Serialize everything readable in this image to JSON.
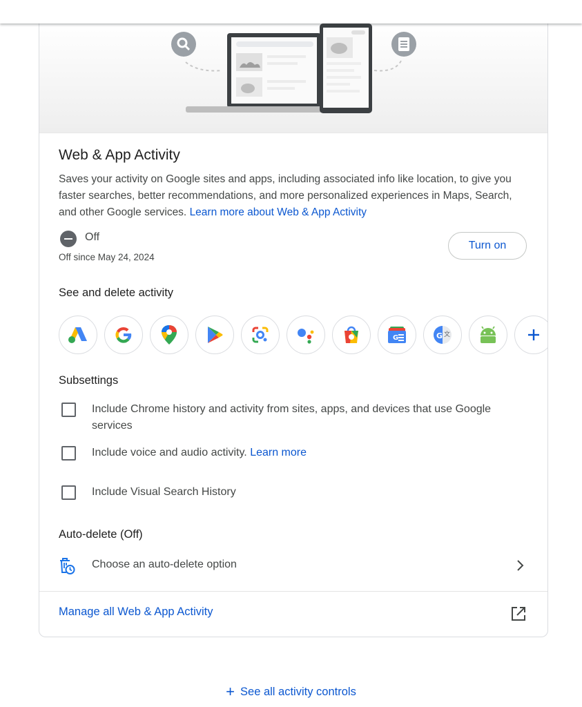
{
  "activity": {
    "title": "Web & App Activity",
    "description": "Saves your activity on Google sites and apps, including associated info like location, to give you faster searches, better recommendations, and more personalized experiences in Maps, Search, and other Google services.",
    "learn_more_link": "Learn more about Web & App Activity",
    "status": "Off",
    "status_since": "Off since May 24, 2024",
    "turn_on_label": "Turn on"
  },
  "see_delete": {
    "heading": "See and delete activity",
    "apps": [
      {
        "icon": "google-ads-icon"
      },
      {
        "icon": "google-icon"
      },
      {
        "icon": "google-maps-icon"
      },
      {
        "icon": "google-play-icon"
      },
      {
        "icon": "google-lens-icon"
      },
      {
        "icon": "google-assistant-icon"
      },
      {
        "icon": "google-shopping-icon"
      },
      {
        "icon": "google-news-icon"
      },
      {
        "icon": "google-translate-icon"
      },
      {
        "icon": "android-icon"
      },
      {
        "icon": "plus-icon"
      }
    ]
  },
  "subsettings": {
    "heading": "Subsettings",
    "items": [
      {
        "label": "Include Chrome history and activity from sites, apps, and devices that use Google services",
        "checked": false
      },
      {
        "label": "Include voice and audio activity.",
        "link": "Learn more",
        "checked": false
      },
      {
        "label": "Include Visual Search History",
        "checked": false
      }
    ]
  },
  "auto_delete": {
    "heading": "Auto-delete (Off)",
    "option_label": "Choose an auto-delete option"
  },
  "manage_link": "Manage all Web & App Activity",
  "see_all_label": "See all activity controls",
  "colors": {
    "accent": "#0b57d0",
    "text": "#1f1f1f",
    "secondary_text": "#444746",
    "border": "#dadce0"
  }
}
